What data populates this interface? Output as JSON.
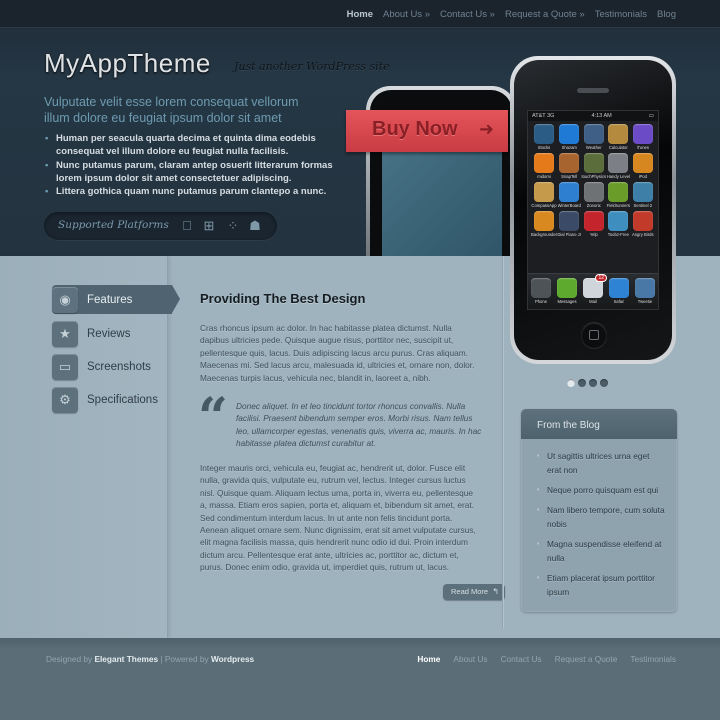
{
  "nav": {
    "items": [
      {
        "label": "Home",
        "active": true
      },
      {
        "label": "About Us »"
      },
      {
        "label": "Contact Us »"
      },
      {
        "label": "Request a Quote »"
      },
      {
        "label": "Testimonials"
      },
      {
        "label": "Blog"
      }
    ]
  },
  "header": {
    "logo": "MyAppTheme",
    "tagline": "Just another WordPress site",
    "lead": "Vulputate velit esse lorem consequat vellorum illum dolore eu feugiat ipsum dolor sit amet",
    "bullets": [
      "Human per seacula quarta decima et quinta dima eodebis consequat vel illum dolore eu feugiat nulla facilisis.",
      "Nunc putamus parum, claram antep osuerit litterarum formas lorem ipsum dolor sit amet consectetuer adipiscing.",
      "Littera gothica quam nunc putamus parum clantepo a nunc."
    ],
    "platforms_label": "Supported Platforms",
    "platforms": [
      {
        "name": "apple-icon",
        "glyph": ""
      },
      {
        "name": "windows-icon",
        "glyph": "⊞"
      },
      {
        "name": "blackberry-icon",
        "glyph": "⁘"
      },
      {
        "name": "android-icon",
        "glyph": "☗"
      }
    ],
    "buy_now": "Buy Now",
    "buy_arrow": "➜"
  },
  "phone": {
    "carrier": "AT&T 3G",
    "time": "4:13 AM",
    "apps": [
      {
        "name": "Stocks",
        "color": "#2a5c86"
      },
      {
        "name": "Shazam",
        "color": "#1f7ad6"
      },
      {
        "name": "Weather",
        "color": "#3f5f86"
      },
      {
        "name": "Calculator",
        "color": "#b48b3e"
      },
      {
        "name": "iTunes",
        "color": "#6b4bc6"
      },
      {
        "name": "midomi",
        "color": "#e57a1a"
      },
      {
        "name": "SnapTell",
        "color": "#a8642e"
      },
      {
        "name": "touchPhysics",
        "color": "#5b6d3a"
      },
      {
        "name": "Handy Level",
        "color": "#7c8086"
      },
      {
        "name": "iPod",
        "color": "#d7871f"
      },
      {
        "name": "CompassApp",
        "color": "#c59a4a"
      },
      {
        "name": "WinterBoard",
        "color": "#2f7fd0"
      },
      {
        "name": "Zonorix",
        "color": "#6e7275"
      },
      {
        "name": "Fieldrunners",
        "color": "#6a9c2a"
      },
      {
        "name": "Sentinel 2",
        "color": "#3d7fa6"
      },
      {
        "name": "Backgrounder",
        "color": "#d88a20"
      },
      {
        "name": "Dial Piano Jr",
        "color": "#3b4a66"
      },
      {
        "name": "Yelp",
        "color": "#c4242c"
      },
      {
        "name": "Toobz-Free",
        "color": "#3e8fc0"
      },
      {
        "name": "Angry Birds",
        "color": "#c23a2a"
      }
    ],
    "dock": [
      {
        "name": "Phone",
        "color": "#4e5358"
      },
      {
        "name": "Messages",
        "color": "#5eaa2e"
      },
      {
        "name": "Mail",
        "color": "#cfd5da"
      },
      {
        "name": "Safari",
        "color": "#2f83d4"
      },
      {
        "name": "Tweetie",
        "color": "#4a78a6"
      }
    ],
    "mail_badge": "12"
  },
  "slider": {
    "count": 4,
    "active": 1
  },
  "tabs": [
    {
      "label": "Features",
      "icon": "eye-icon",
      "glyph": "◉",
      "active": true
    },
    {
      "label": "Reviews",
      "icon": "trophy-icon",
      "glyph": "🏆"
    },
    {
      "label": "Screenshots",
      "icon": "monitor-icon",
      "glyph": "🖵"
    },
    {
      "label": "Specifications",
      "icon": "gears-icon",
      "glyph": "⚙"
    }
  ],
  "content": {
    "heading": "Providing The Best Design",
    "para1": "Cras rhoncus ipsum ac dolor. In hac habitasse platea dictumst. Nulla dapibus ultricies pede. Quisque augue risus, porttitor nec, suscipit ut, pellentesque quis, lacus. Duis adipiscing lacus arcu purus. Cras aliquam. Maecenas mi. Sed lacus arcu, malesuada id, ultricies et, ornare non, dolor. Maecenas turpis lacus, vehicula nec, blandit in, laoreet a, nibh.",
    "quote": "Donec aliquet. In et leo tincidunt tortor rhoncus convallis. Nulla facilisi. Praesent bibendum semper eros. Morbi risus. Nam tellus leo, ullamcorper egestas, venenatis quis, viverra ac, mauris. In hac habitasse platea dictumst curabitur at.",
    "para2": "Integer mauris orci, vehicula eu, feugiat ac, hendrerit ut, dolor. Fusce elit nulla, gravida quis, vulputate eu, rutrum vel, lectus. Integer cursus luctus nisl. Quisque quam. Aliquam lectus urna, porta in, viverra eu, pellentesque a, massa. Etiam eros sapien, porta et, aliquam et, bibendum sit amet, erat. Sed condimentum interdum lacus. In ut ante non felis tincidunt porta. Aenean aliquet ornare sem. Nunc dignissim, erat sit amet vulputate cursus, elit magna facilisis massa, quis hendrerit nunc odio id dui. Proin interdum dictum arcu. Pellentesque erat ante, ultricies ac, porttitor ac, dictum et, purus. Donec enim odio, gravida ut, imperdiet quis, rutrum ut, lacus.",
    "read_more": "Read More",
    "read_more_arrow": "↰"
  },
  "blog": {
    "title": "From the Blog",
    "items": [
      "Ut sagittis ultrices urna eget erat non",
      "Neque porro quisquam est qui",
      "Nam libero tempore, cum soluta nobis",
      "Magna suspendisse eleifend at nulla",
      "Etiam placerat ipsum porttitor ipsum"
    ]
  },
  "footer": {
    "designed_by": "Designed by",
    "designer": "Elegant Themes",
    "powered_by": "| Powered by",
    "platform": "Wordpress",
    "nav": [
      {
        "label": "Home",
        "active": true
      },
      {
        "label": "About Us"
      },
      {
        "label": "Contact Us"
      },
      {
        "label": "Request a Quote"
      },
      {
        "label": "Testimonials"
      }
    ]
  }
}
